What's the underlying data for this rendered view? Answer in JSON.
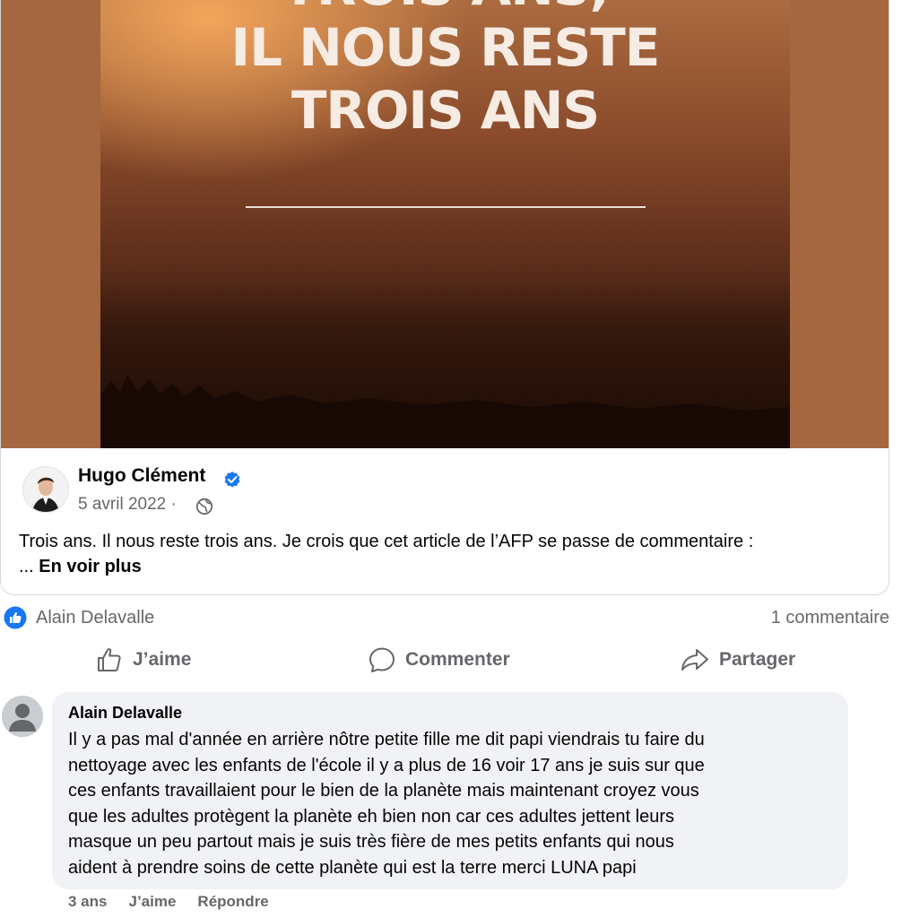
{
  "hero": {
    "headline_line0": "TROIS ANS,",
    "headline_line1": "IL NOUS RESTE",
    "headline_line2": "TROIS ANS"
  },
  "post": {
    "author": "Hugo Clément",
    "date": "5 avril 2022 ·",
    "text": "Trois ans. Il nous reste trois ans. Je crois que cet article de l’AFP se passe de commentaire :",
    "ellipsis": "... ",
    "see_more": "En voir plus"
  },
  "stats": {
    "liker": "Alain Delavalle",
    "comment_count": "1 commentaire"
  },
  "actions": {
    "like": "J’aime",
    "comment": "Commenter",
    "share": "Partager"
  },
  "comment": {
    "author": "Alain Delavalle",
    "lines": [
      "Il y a pas mal d'année en arrière nôtre petite fille me dit papi viendrais tu faire du",
      "nettoyage avec les enfants de l'école il y a plus de 16 voir 17 ans je suis sur que",
      "ces enfants travaillaient pour le bien de la planète mais maintenant croyez vous",
      "que les adultes protègent la planète eh bien non car ces adultes jettent leurs",
      "masque un peu partout mais je suis très fière de mes petits enfants qui nous",
      "aident à prendre soins de cette planète qui est la terre merci LUNA papi"
    ],
    "time": "3 ans",
    "like": "J’aime",
    "reply": "Répondre"
  },
  "colors": {
    "facebook_blue": "#1877f2",
    "secondary_text": "#65676b",
    "bubble_bg": "#f0f2f5",
    "hero_side": "#a4673f"
  }
}
